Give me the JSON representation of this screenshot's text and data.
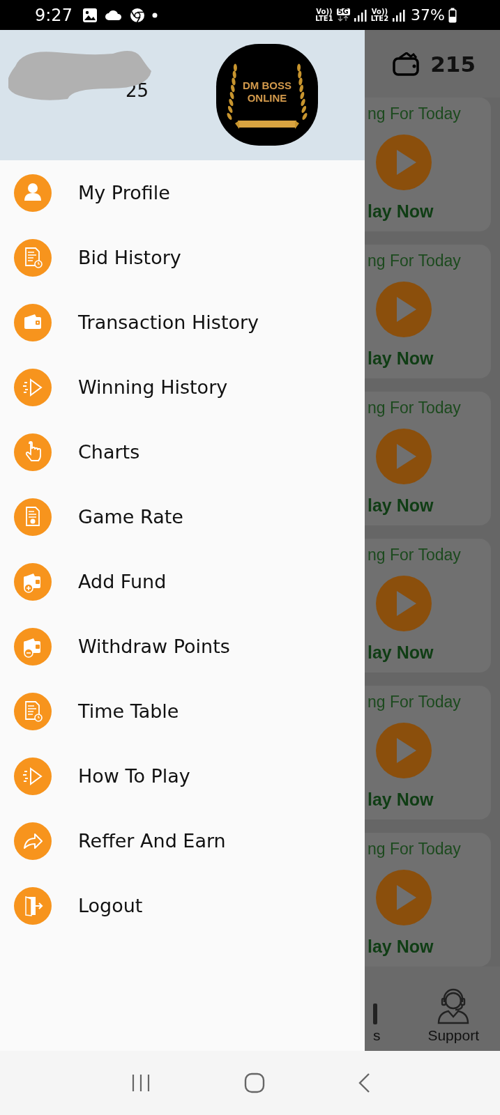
{
  "status_bar": {
    "time": "9:27",
    "sim_1": {
      "volte": "Vo))",
      "network": "LTE1"
    },
    "data": "5G",
    "sim_2": {
      "volte": "Vo))",
      "network": "LTE2"
    },
    "battery": "37%"
  },
  "drawer": {
    "header": {
      "visible_text": "25",
      "logo_lines": [
        "DM BOSS",
        "ONLINE"
      ]
    },
    "items": [
      {
        "label": "My Profile",
        "kind": "person"
      },
      {
        "label": "Bid History",
        "kind": "report"
      },
      {
        "label": "Transaction History",
        "kind": "wallet"
      },
      {
        "label": "Winning History",
        "kind": "play"
      },
      {
        "label": "Charts",
        "kind": "hand"
      },
      {
        "label": "Game Rate",
        "kind": "rate"
      },
      {
        "label": "Add Fund",
        "kind": "wallet-plus"
      },
      {
        "label": "Withdraw Points",
        "kind": "wallet-minus"
      },
      {
        "label": "Time Table",
        "kind": "report"
      },
      {
        "label": "How To Play",
        "kind": "play"
      },
      {
        "label": "Reffer And Earn",
        "kind": "share"
      },
      {
        "label": "Logout",
        "kind": "logout"
      }
    ]
  },
  "background": {
    "balance": "215",
    "cards": [
      {
        "title": "ng For Today",
        "action": "lay Now"
      },
      {
        "title": "ng For Today",
        "action": "lay Now"
      },
      {
        "title": "ng For Today",
        "action": "lay Now"
      },
      {
        "title": "ng For Today",
        "action": "lay Now"
      },
      {
        "title": "ng For Today",
        "action": "lay Now"
      },
      {
        "title": "ng For Today",
        "action": "lay Now"
      }
    ],
    "bottom_nav": [
      {
        "label": "s",
        "kind": "cut"
      },
      {
        "label": "Support",
        "kind": "support"
      }
    ]
  }
}
